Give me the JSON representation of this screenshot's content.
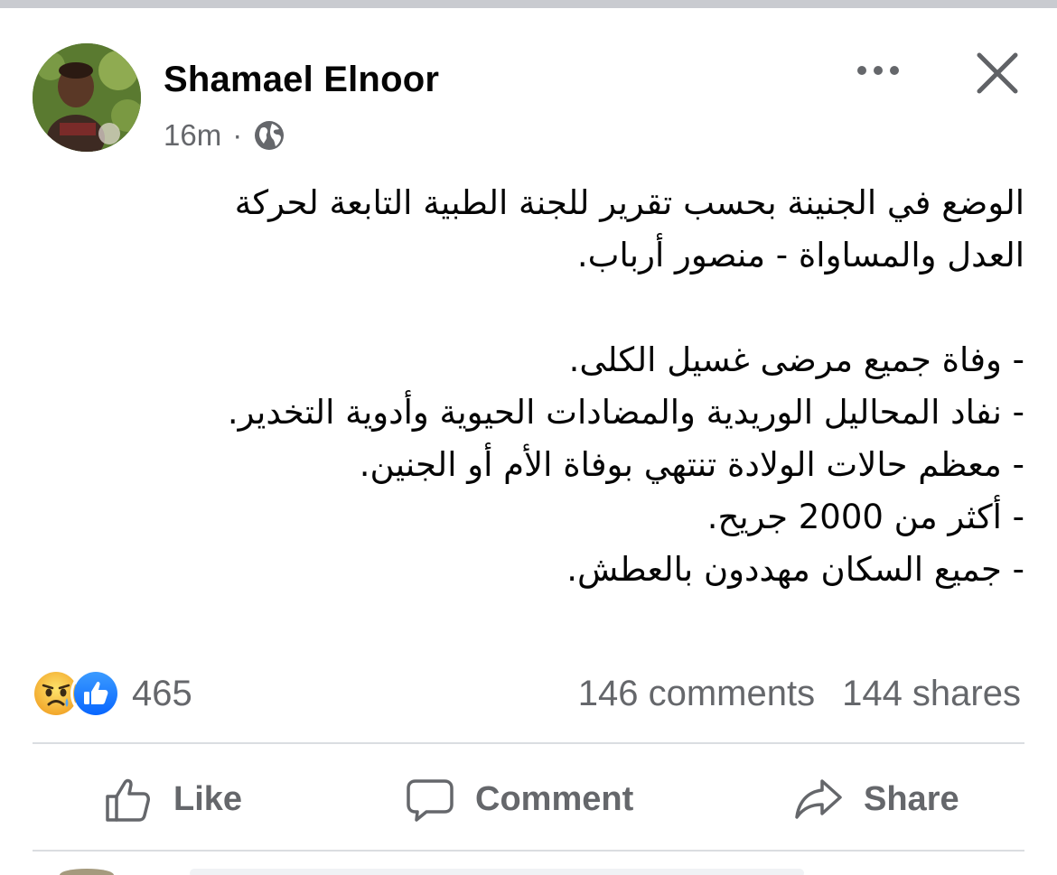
{
  "post": {
    "author": "Shamael Elnoor",
    "time": "16m",
    "separator": "·",
    "privacy_icon": "globe-icon",
    "text_lines": [
      "الوضع في الجنينة بحسب تقرير للجنة الطبية التابعة لحركة",
      "العدل والمساواة - منصور أرباب.",
      "",
      "- وفاة جميع مرضى غسيل الكلى.",
      "- نفاد المحاليل الوريدية والمضادات الحيوية وأدوية التخدير.",
      "- معظم حالات الولادة تنتهي بوفاة الأم أو الجنين.",
      "- أكثر من 2000 جريح.",
      "- جميع السكان مهددون بالعطش."
    ]
  },
  "header_actions": {
    "more_icon": "more-horizontal-icon",
    "close_icon": "close-icon"
  },
  "stats": {
    "reaction_icons": [
      "sad-reaction-icon",
      "like-reaction-icon"
    ],
    "reactions_count": "465",
    "comments": "146 comments",
    "shares": "144 shares"
  },
  "actions": {
    "like_label": "Like",
    "comment_label": "Comment",
    "share_label": "Share"
  },
  "colors": {
    "text_primary": "#050505",
    "text_secondary": "#65676b",
    "divider": "#dadde1",
    "like_blue": "#1877f2",
    "sad_yellow": "#f7b928"
  }
}
